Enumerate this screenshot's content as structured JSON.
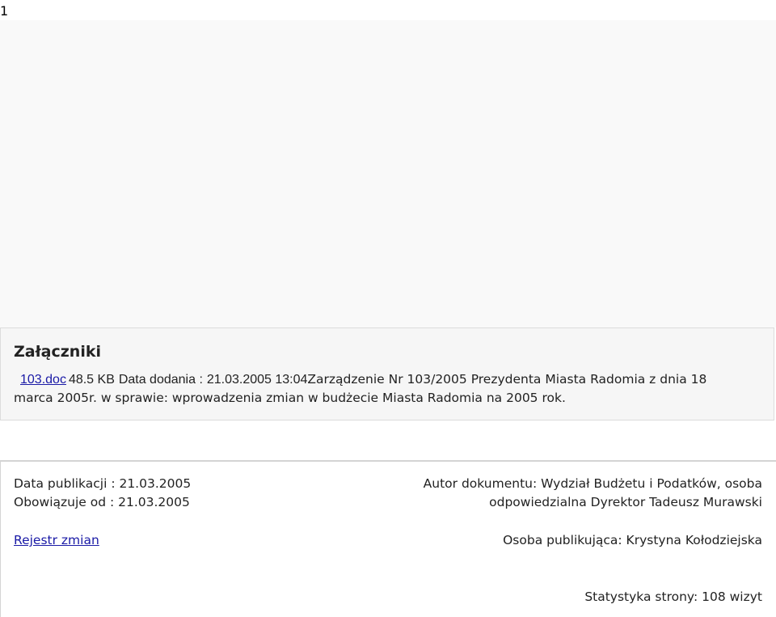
{
  "page": {
    "number": "1"
  },
  "attachments": {
    "title": "Załączniki",
    "file": {
      "name": "103.doc",
      "size": "48.5 KB",
      "added_label": "Data dodania :",
      "added_value": "21.03.2005 13:04",
      "description_line_1": "Zarządzenie Nr 103/2005 Prezydenta Miasta Radomia z dnia 18",
      "description_line_2": "marca 2005r. w sprawie: wprowadzenia zmian w budżecie Miasta Radomia na 2005 rok."
    }
  },
  "document_info": {
    "publication_date": "Data publikacji : 21.03.2005",
    "effective_date": "Obowiązuje od : 21.03.2005",
    "register_link": "Rejestr zmian",
    "author_line_1": "Autor dokumentu: Wydział Budżetu i Podatków, osoba",
    "author_line_2": "odpowiedzialna Dyrektor Tadeusz Murawski",
    "publisher": "Osoba publikująca: Krystyna Kołodziejska"
  },
  "stats": {
    "text": "Statystyka strony: 108 wizyt"
  }
}
